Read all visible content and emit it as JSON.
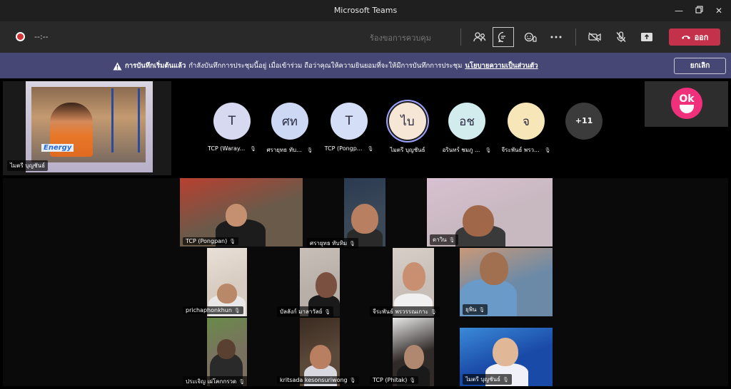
{
  "window": {
    "title": "Microsoft Teams"
  },
  "toolbar": {
    "timer": "--:--",
    "ask_control": "ร้องขอการควบคุม",
    "leave_label": "ออก"
  },
  "banner": {
    "title": "การบันทึกเริ่มต้นแล้ว",
    "message": "กำลังบันทึกการประชุมนี้อยู่ เมื่อเข้าร่วม ถือว่าคุณให้ความยินยอมที่จะให้มีการบันทึกการประชุม",
    "link": "นโยบายความเป็นส่วนตัว",
    "cancel_label": "ยกเลิก"
  },
  "spotlight": {
    "name": "ไมตรี บุญชันธ์",
    "logo_text": "Energy"
  },
  "avatars": [
    {
      "initials": "T",
      "label": "TCP (Waray...",
      "color": "#d6d9f0"
    },
    {
      "initials": "ศท",
      "label": "ศรายุทธ ทับ...",
      "color": "#cdd8f5"
    },
    {
      "initials": "T",
      "label": "TCP (Pongp...",
      "color": "#d4def6"
    },
    {
      "initials": "ไบ",
      "label": "ไมตรี บุญชันธ์",
      "color": "#f6e6d6"
    },
    {
      "initials": "อช",
      "label": "อรินทร์ ชมภู ...",
      "color": "#d2ecee"
    },
    {
      "initials": "จ",
      "label": "จีระพันธ์ พรว...",
      "color": "#f6e6b8"
    }
  ],
  "more_count": "+11",
  "selfview": {
    "logo_top": "Ok"
  },
  "gallery": [
    {
      "name": "TCP (Pongpan)",
      "bg": "#6a5a4a",
      "head": "#c49070",
      "shirt": "#1c1c1c",
      "accent": "#b84030"
    },
    {
      "name": "ศรายุทธ ทับทิม",
      "bg": "#3a4858",
      "head": "#b88060",
      "shirt": "#2a2a2a",
      "accent": "#2a3a50"
    },
    {
      "name": "ดาวิน",
      "bg": "#c8b8c0",
      "head": "#a06848",
      "shirt": "#3a3a3a",
      "accent": "#d8c0d0"
    },
    {
      "name": "prichaphonkhun",
      "bg": "#d8ccc0",
      "head": "#b88868",
      "shirt": "#e8e8e8",
      "accent": "#e8e0d8"
    },
    {
      "name": "บัลลังก์ มาลาวัลย์",
      "bg": "#b8b0a8",
      "head": "#7a5040",
      "shirt": "#1a1a1a",
      "accent": "#c8c0b8"
    },
    {
      "name": "จีระพันธ์ พรวรรณเกาะ",
      "bg": "#c8c0b8",
      "head": "#c89070",
      "shirt": "#f0f0f0",
      "accent": "#d8d0c8"
    },
    {
      "name": "ยุพิน",
      "bg": "#6a8aa8",
      "head": "#a07050",
      "shirt": "#6a9ac8",
      "accent": "#c89878"
    },
    {
      "name": "ประเจิญ เผ่โคกกรวด",
      "bg": "#7a7060",
      "head": "#5a4030",
      "shirt": "#2a2a2a",
      "accent": "#6a8a4a"
    },
    {
      "name": "kritsada kesonsuriwong",
      "bg": "#5a4838",
      "head": "#b88060",
      "shirt": "#d8d8e0",
      "accent": "#3a2a20"
    },
    {
      "name": "TCP (Phitak)",
      "bg": "#302a28",
      "head": "#b08870",
      "shirt": "#1a1a1a",
      "accent": "#e8e8e8"
    },
    {
      "name": "ไมตรี บุญชันธ์",
      "bg": "#1a4aa8",
      "head": "#e0b898",
      "shirt": "#f0f0f8",
      "accent": "#3a8ad8"
    }
  ]
}
